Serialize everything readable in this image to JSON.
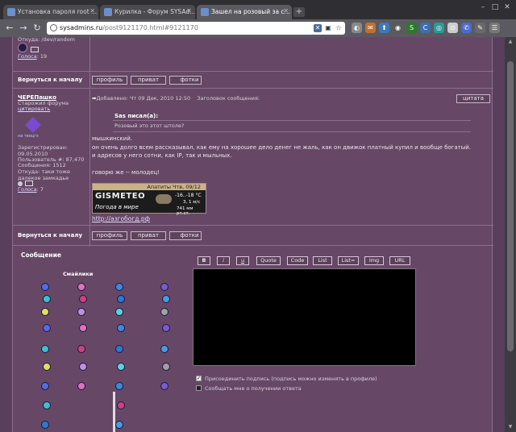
{
  "browser": {
    "tabs": [
      {
        "title": "Установка пароля root ...",
        "active": false
      },
      {
        "title": "Курилка - Форум SYSAd...",
        "active": false
      },
      {
        "title": "Зашел на розовый за с...",
        "active": true
      }
    ],
    "new_tab": "+",
    "window_controls": [
      "–",
      "□",
      "✕"
    ],
    "nav": {
      "back": "←",
      "forward": "→",
      "reload": "↻"
    },
    "url_host": "sysadmins.ru",
    "url_path": "/post9121170.html#9121170",
    "extensions": [
      {
        "name": "ext-one-icon",
        "color": "#888888",
        "glyph": "◐"
      },
      {
        "name": "ext-two-icon",
        "color": "#c07030",
        "glyph": "✉"
      },
      {
        "name": "ext-three-icon",
        "color": "#3a79c0",
        "glyph": "⬆"
      },
      {
        "name": "ext-four-icon",
        "color": "#5a5a5a",
        "glyph": "◉"
      },
      {
        "name": "ext-five-icon",
        "color": "#2a7a2a",
        "glyph": "S"
      },
      {
        "name": "ext-six-icon",
        "color": "#3c6eb0",
        "glyph": "C"
      },
      {
        "name": "ext-seven-icon",
        "color": "#2a9a9a",
        "glyph": "◎"
      },
      {
        "name": "ext-eight-icon",
        "color": "#cccccc",
        "glyph": "⊙"
      },
      {
        "name": "ext-nine-icon",
        "color": "#4a6ad0",
        "glyph": "✆"
      },
      {
        "name": "ext-ten-icon",
        "color": "#6a6a6a",
        "glyph": "✎"
      },
      {
        "name": "ext-eleven-icon",
        "color": "#777777",
        "glyph": "☰"
      }
    ]
  },
  "prev_post": {
    "location": "Откуда: /dev/random",
    "votes": "Голоса",
    "votes_count": ": 19",
    "back_to_top": "Вернуться к началу",
    "buttons": [
      "профиль",
      "приват",
      "фотки"
    ]
  },
  "post": {
    "author": "ЧЕРЕПашко",
    "rank": "Старожил форума",
    "quote_link": "цитировать",
    "avatar_caption": "на твоцгэ",
    "registered_label": "Зарегистрирован:",
    "registered_date": "09.05.2010",
    "user_no": "Пользователь #: 87,470",
    "messages": "Сообщения: 1512",
    "from": "Откуда: таки тоже далекое замкадье",
    "votes": "Голоса",
    "votes_count": ": 7",
    "added": "Добавлено: Чт 09 Дек, 2010 12:50",
    "subject_label": "Заголовок сообщения:",
    "cite_button": "цитата",
    "quote_author": "Sas писал(а):",
    "quote_text": "Розовый это этот штоле?",
    "body_lines": [
      "мышкинский.",
      "он очень долго всем рассказывал, как ему на хорошее дело денег не жаль, как он движок платный купил и вообще богатый.",
      "и адресов у него сотни, как IP, так и мыльных.",
      "",
      "говорю же -- молодец!"
    ],
    "signature_link": "http://азгобогд.рф",
    "back_to_top": "Вернуться к началу",
    "buttons": [
      "профиль",
      "приват",
      "фотки"
    ]
  },
  "weather": {
    "header": "Апатиты Чтв, 09/12",
    "brand": "GISMETEO",
    "slogan": "Погода в мире",
    "temp": "-16..-18 °C",
    "wind": "З, 1 м/с",
    "pressure": "741 мм рт.ст."
  },
  "reply": {
    "title": "Сообщение",
    "smilies_title": "Смайлики",
    "format_buttons": [
      "B",
      "i",
      "u",
      "Quote",
      "Code",
      "List",
      "List=",
      "Img",
      "URL"
    ],
    "attach_signature": "Присоединить подпись (подпись можно изменять в профиле)",
    "notify": "Сообщать мне о получении ответа",
    "attach_signature_checked": true,
    "notify_checked": false
  },
  "colors": {
    "page_bg": "#5a3f5c",
    "frame_bg": "#664866",
    "link": "#e0d8ff"
  }
}
